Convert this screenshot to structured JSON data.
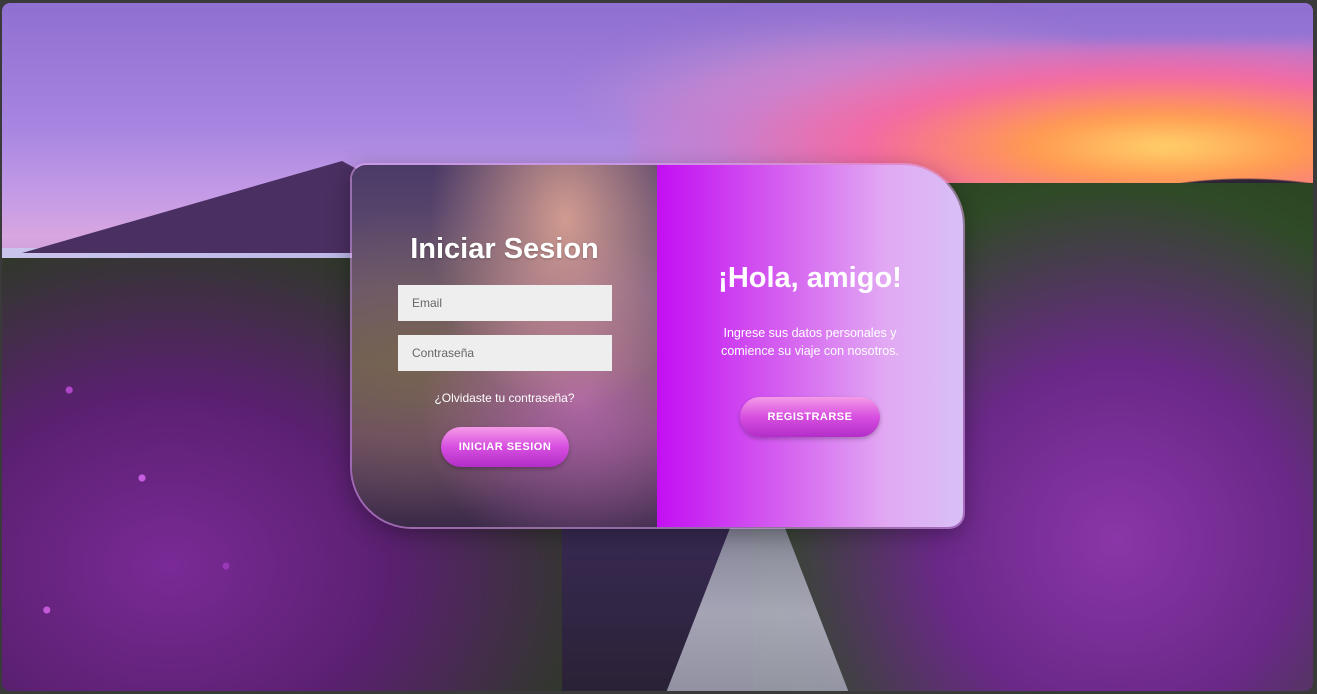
{
  "login": {
    "title": "Iniciar Sesion",
    "email_placeholder": "Email",
    "password_placeholder": "Contraseña",
    "forgot_link": "¿Olvidaste tu contraseña?",
    "submit_label": "INICIAR SESION"
  },
  "welcome": {
    "title": "¡Hola, amigo!",
    "message": "Ingrese sus datos personales y comience su viaje con nosotros.",
    "register_label": "REGISTRARSE"
  },
  "colors": {
    "accent": "#c30ff2",
    "button": "#d74fe0"
  }
}
